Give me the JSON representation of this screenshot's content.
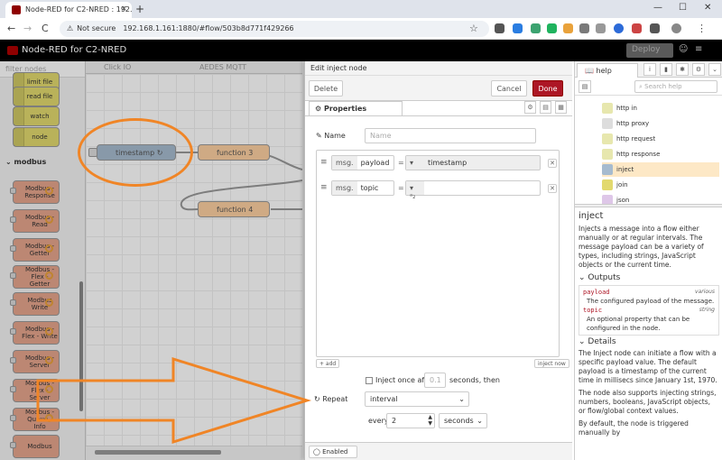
{
  "browser": {
    "tab_title": "Node-RED for C2-NRED : 192.1",
    "tab_close": "×",
    "new_tab": "+",
    "win_min": "—",
    "win_max": "☐",
    "win_close": "✕",
    "back": "←",
    "forward": "→",
    "reload": "C",
    "security": "Not secure",
    "url": "192.168.1.161:1880/#flow/503b8d771f429266",
    "bookmark_star": "☆",
    "menu": "⋮"
  },
  "nr": {
    "title": "Node-RED for C2-NRED",
    "deploy": "Deploy",
    "menu_icon": "≡"
  },
  "palette": {
    "filter_placeholder": "filter nodes",
    "top_nodes": [
      "limit file",
      "read file",
      "watch",
      "node"
    ],
    "category": "modbus",
    "modbus_nodes": [
      "Modbus - Response",
      "Modbus - Read",
      "Modbus - Getter",
      "Modbus - Flex - Getter",
      "Modbus Write",
      "Modbus - Flex - Write",
      "Modbus - Server",
      "Modbus - Flex - Server",
      "Modbus - Queue - Info",
      "Modbus"
    ]
  },
  "canvas": {
    "tabs": [
      "Click IO",
      "AEDES MQTT"
    ],
    "nodes": {
      "timestamp": "timestamp ↻",
      "function3": "function 3",
      "function4": "function 4"
    }
  },
  "editor": {
    "title": "Edit inject node",
    "delete": "Delete",
    "cancel": "Cancel",
    "done": "Done",
    "properties_tab": "Properties",
    "name_label": "Name",
    "name_placeholder": "Name",
    "rows": [
      {
        "prefix": "msg.",
        "prop": "payload",
        "eq": "=",
        "type_icon": "▾",
        "value": "timestamp"
      },
      {
        "prefix": "msg.",
        "prop": "topic",
        "eq": "=",
        "type_icon": "▾ ᵃ₂",
        "value": ""
      }
    ],
    "remove": "✕",
    "add": "+ add",
    "inject_now": "inject now",
    "inject_once_label": "Inject once after",
    "inject_once_value": "0.1",
    "seconds_then": "seconds, then",
    "repeat_label": "Repeat",
    "repeat_value": "interval",
    "every_label": "every",
    "every_value": "2",
    "units_value": "seconds",
    "enabled": "Enabled"
  },
  "sidebar": {
    "tab": "help",
    "search_placeholder": "Search help",
    "tree": [
      {
        "label": "http in",
        "color": "#e7e7ae"
      },
      {
        "label": "http proxy",
        "color": "#dddddd"
      },
      {
        "label": "http request",
        "color": "#e7e7ae"
      },
      {
        "label": "http response",
        "color": "#e7e7ae"
      },
      {
        "label": "inject",
        "color": "#a6bbcf"
      },
      {
        "label": "join",
        "color": "#e2d96e"
      },
      {
        "label": "json",
        "color": "#dec7e8"
      }
    ],
    "help": {
      "title": "inject",
      "intro": "Injects a message into a flow either manually or at regular intervals. The message payload can be a variety of types, including strings, JavaScript objects or the current time.",
      "outputs_heading": "Outputs",
      "out1_name": "payload",
      "out1_type": "various",
      "out1_desc": "The configured payload of the message.",
      "out2_name": "topic",
      "out2_type": "string",
      "out2_desc": "An optional property that can be configured in the node.",
      "details_heading": "Details",
      "details1": "The Inject node can initiate a flow with a specific payload value. The default payload is a timestamp of the current time in millisecs since January 1st, 1970.",
      "details2": "The node also supports injecting strings, numbers, booleans, JavaScript objects, or flow/global context values.",
      "details3": "By default, the node is triggered manually by"
    }
  },
  "colors": {
    "accent_red": "#ad1625",
    "annotation_orange": "#f08526",
    "modbus_node": "#e6a58d",
    "storage_node": "#e2d96e"
  }
}
